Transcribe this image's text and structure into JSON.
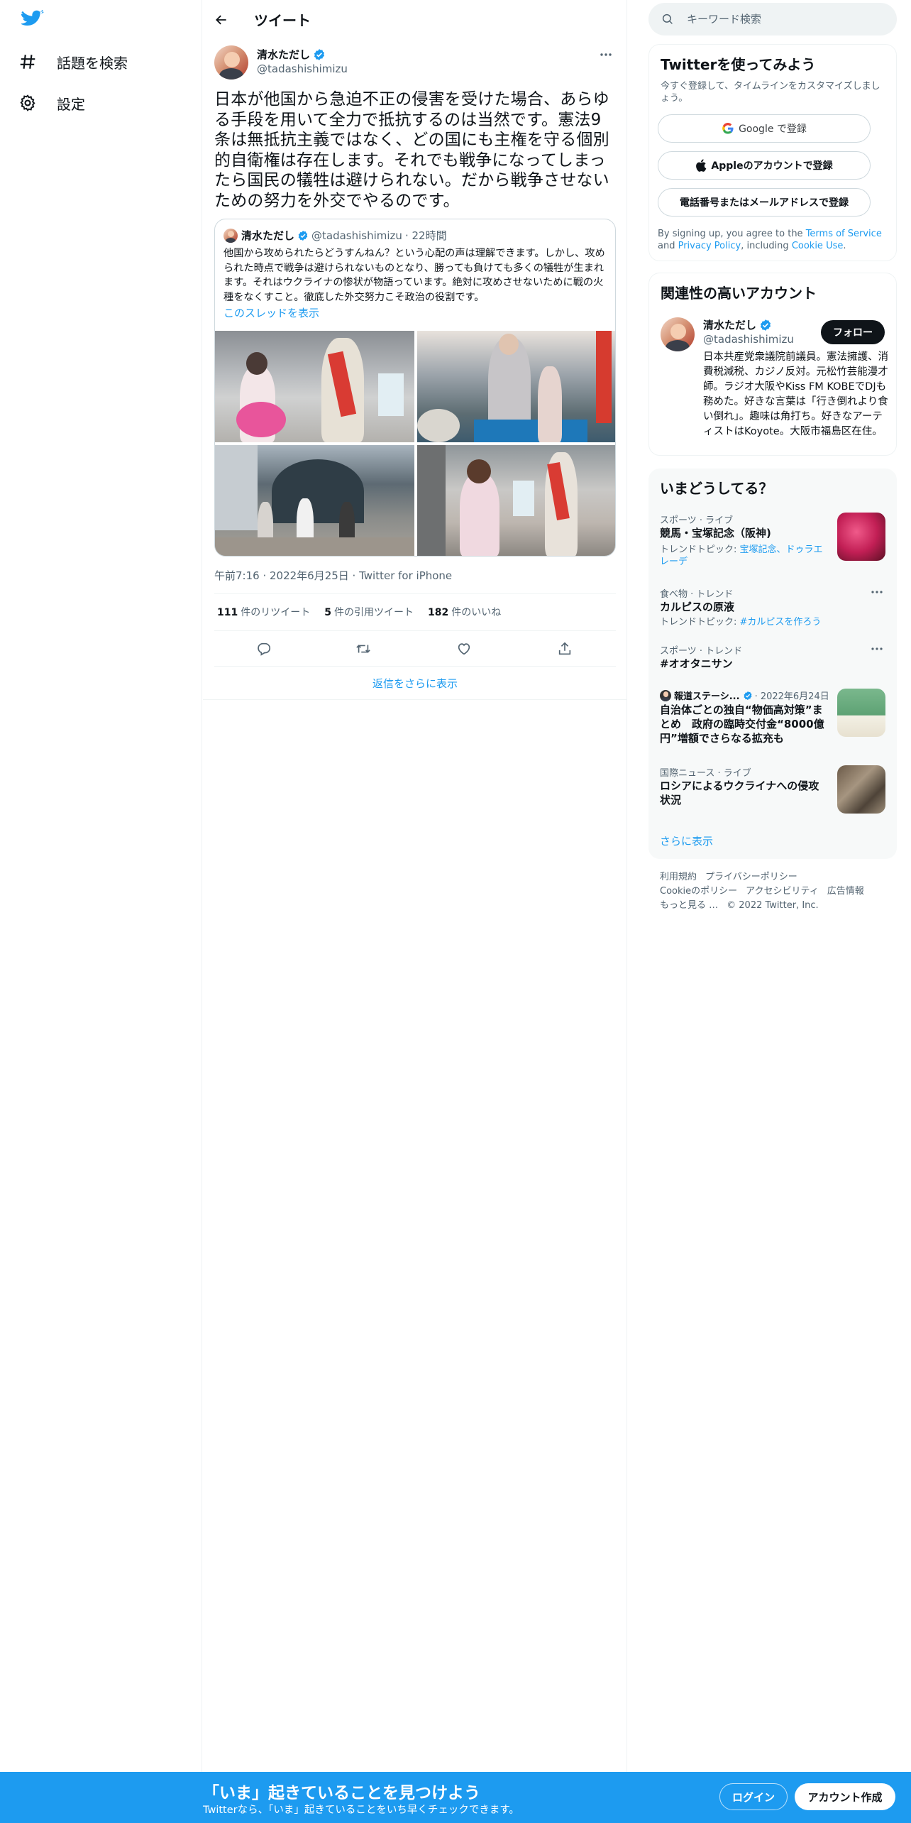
{
  "colors": {
    "accent": "#1d9bf0",
    "text": "#0f1419",
    "secondary": "#536471"
  },
  "nav": {
    "logo": "twitter-bird-icon",
    "items": [
      {
        "label": "話題を検索",
        "icon": "hashtag-icon"
      },
      {
        "label": "設定",
        "icon": "gear-icon"
      }
    ]
  },
  "header": {
    "title": "ツイート"
  },
  "tweet": {
    "name": "清水ただし",
    "handle": "@tadashishimizu",
    "text": "日本が他国から急迫不正の侵害を受けた場合、あらゆる手段を用いて全力で抵抗するのは当然です。憲法9条は無抵抗主義ではなく、どの国にも主権を守る個別的自衛権は存在します。それでも戦争になってしまったら国民の犠牲は避けられない。だから戦争させないための努力を外交でやるのです。",
    "quote": {
      "name": "清水ただし",
      "handle": "@tadashishimizu",
      "time": "· 22時間",
      "text": "他国から攻められたらどうすんねん？という心配の声は理解できます。しかし、攻められた時点で戦争は避けられないものとなり、勝っても負けても多くの犠牲が生まれます。それはウクライナの惨状が物語っています。絶対に攻めさせないために戦の火種をなくすこと。徹底した外交努力こそ政治の役割です。",
      "thread_link": "このスレッドを表示"
    },
    "meta": "午前7:16 · 2022年6月25日 · Twitter for iPhone",
    "stats": {
      "retweets_count": "111",
      "retweets_label": "件のリツイート",
      "quotes_count": "5",
      "quotes_label": "件の引用ツイート",
      "likes_count": "182",
      "likes_label": "件のいいね"
    },
    "show_replies": "返信をさらに表示"
  },
  "search": {
    "placeholder": "キーワード検索"
  },
  "signup_card": {
    "title": "Twitterを使ってみよう",
    "desc": "今すぐ登録して、タイムラインをカスタマイズしましょう。",
    "google": "Google で登録",
    "apple": "Appleのアカウントで登録",
    "phone": "電話番号またはメールアドレスで登録",
    "terms_prefix": "By signing up, you agree to the ",
    "terms_link": "Terms of Service",
    "terms_and": " and ",
    "privacy_link": "Privacy Policy",
    "terms_including": ", including ",
    "cookie_link": "Cookie Use",
    "terms_end": "."
  },
  "related": {
    "title": "関連性の高いアカウント",
    "name": "清水ただし",
    "handle": "@tadashishimizu",
    "follow": "フォロー",
    "bio": "日本共産党衆議院前議員。憲法擁護、消費税減税、カジノ反対。元松竹芸能漫才師。ラジオ大阪やKiss FM KOBEでDJも務めた。好きな言葉は「行き倒れより食い倒れ」。趣味は角打ち。好きなアーティストはKoyote。大阪市福島区在住。"
  },
  "trends": {
    "title": "いまどうしてる？",
    "items": [
      {
        "category": "スポーツ · ライブ",
        "title": "競馬・宝塚記念（阪神)",
        "topics_label": "トレンドトピック: ",
        "topics": "宝塚記念、ドゥラエレーデ"
      },
      {
        "category": "食べ物 · トレンド",
        "title": "カルピスの原液",
        "topics_label": "トレンドトピック: ",
        "topics": "#カルピスを作ろう"
      },
      {
        "category": "スポーツ · トレンド",
        "title": "#オオタニサン"
      },
      {
        "source": "報道ステーシ...",
        "date": "· 2022年6月24日",
        "title": "自治体ごとの独自“物価高対策”まとめ　政府の臨時交付金“8000億円”増額でさらなる拡充も"
      },
      {
        "category": "国際ニュース · ライブ",
        "title": "ロシアによるウクライナへの侵攻状況"
      }
    ],
    "show_more": "さらに表示"
  },
  "footer": {
    "links": [
      "利用規約",
      "プライバシーポリシー",
      "Cookieのポリシー",
      "アクセシビリティ",
      "広告情報",
      "もっと見る …"
    ],
    "copyright": "© 2022 Twitter, Inc."
  },
  "bottombar": {
    "title": "「いま」起きていることを見つけよう",
    "subtitle": "Twitterなら、「いま」起きていることをいち早くチェックできます。",
    "login": "ログイン",
    "signup": "アカウント作成"
  }
}
